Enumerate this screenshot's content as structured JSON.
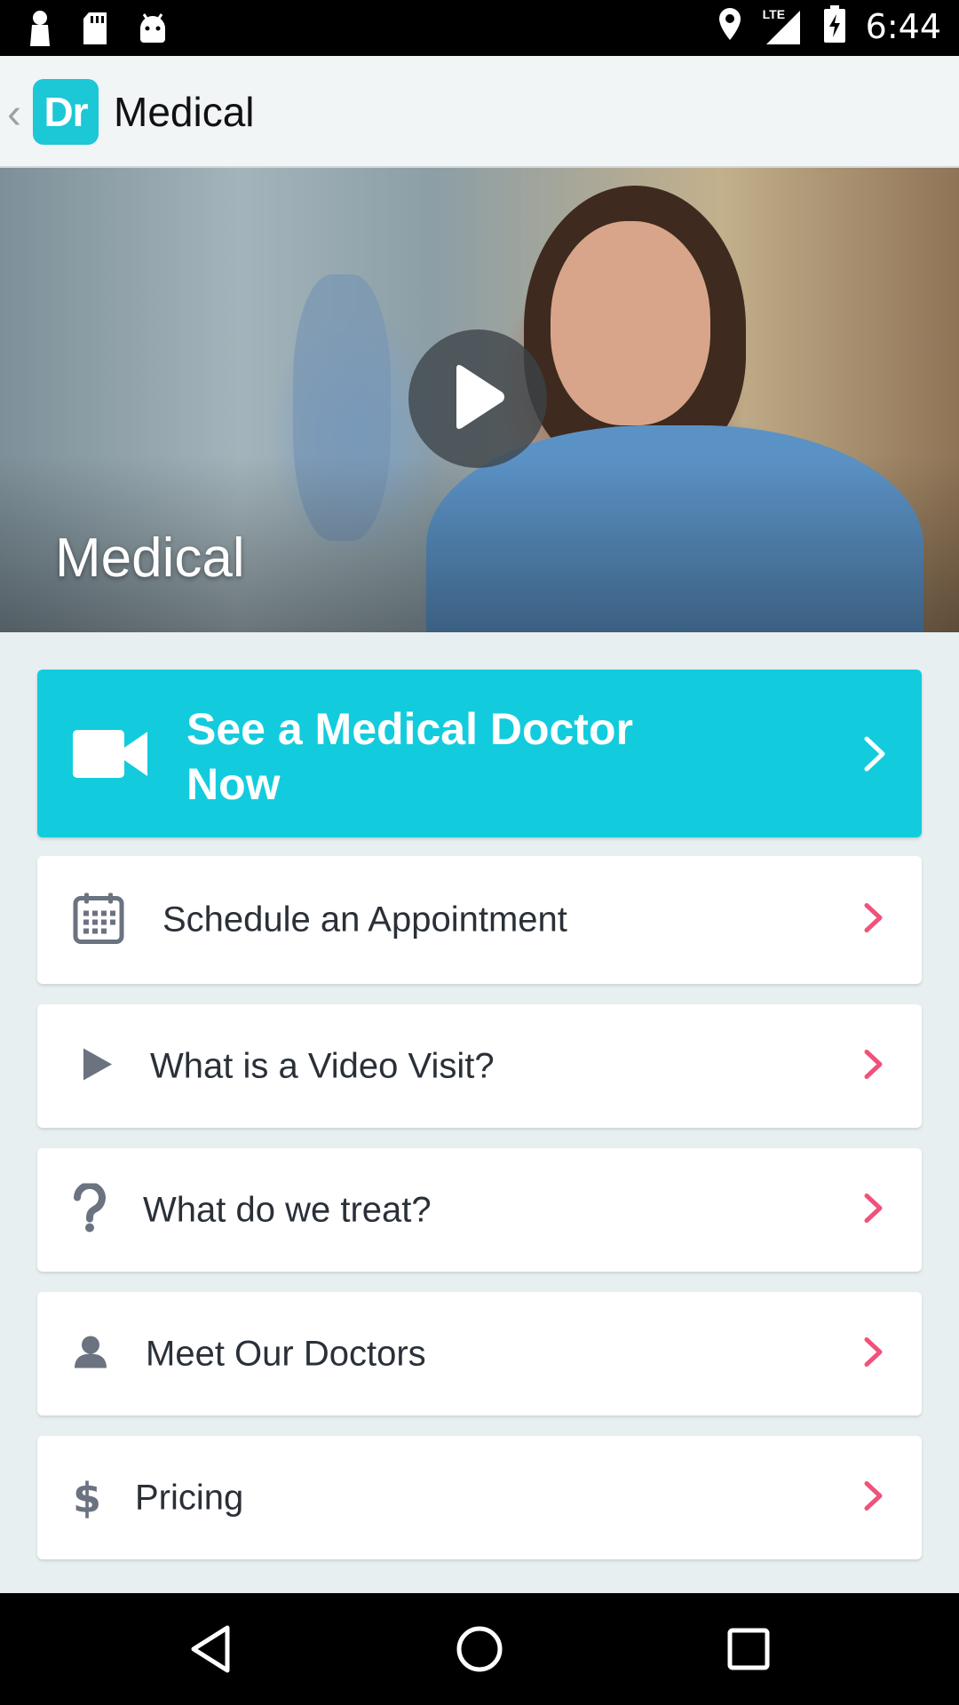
{
  "status_bar": {
    "time": "6:44",
    "network": "LTE",
    "icons": [
      "notification-icon",
      "sd-card-icon",
      "android-icon",
      "location-icon",
      "signal-icon",
      "battery-charging-icon"
    ]
  },
  "action_bar": {
    "back_icon": "back-chevron-icon",
    "logo_text": "Dr",
    "title": "Medical",
    "logo_color": "#1cc7d6"
  },
  "hero": {
    "title": "Medical",
    "play_icon": "play-icon"
  },
  "cta": {
    "label": "See a Medical Doctor Now",
    "icon": "video-camera-icon",
    "color": "#12ccdd"
  },
  "menu": {
    "items": [
      {
        "label": "Schedule an Appointment",
        "icon": "calendar-icon"
      },
      {
        "label": "What is a Video Visit?",
        "icon": "play-icon"
      },
      {
        "label": "What do we treat?",
        "icon": "question-icon"
      },
      {
        "label": "Meet Our Doctors",
        "icon": "person-icon"
      },
      {
        "label": "Pricing",
        "icon": "dollar-icon"
      }
    ],
    "chevron_color": "#f0527a",
    "icon_color": "#6b7280"
  },
  "nav_bar": {
    "buttons": [
      "back-icon",
      "home-icon",
      "recents-icon"
    ]
  }
}
